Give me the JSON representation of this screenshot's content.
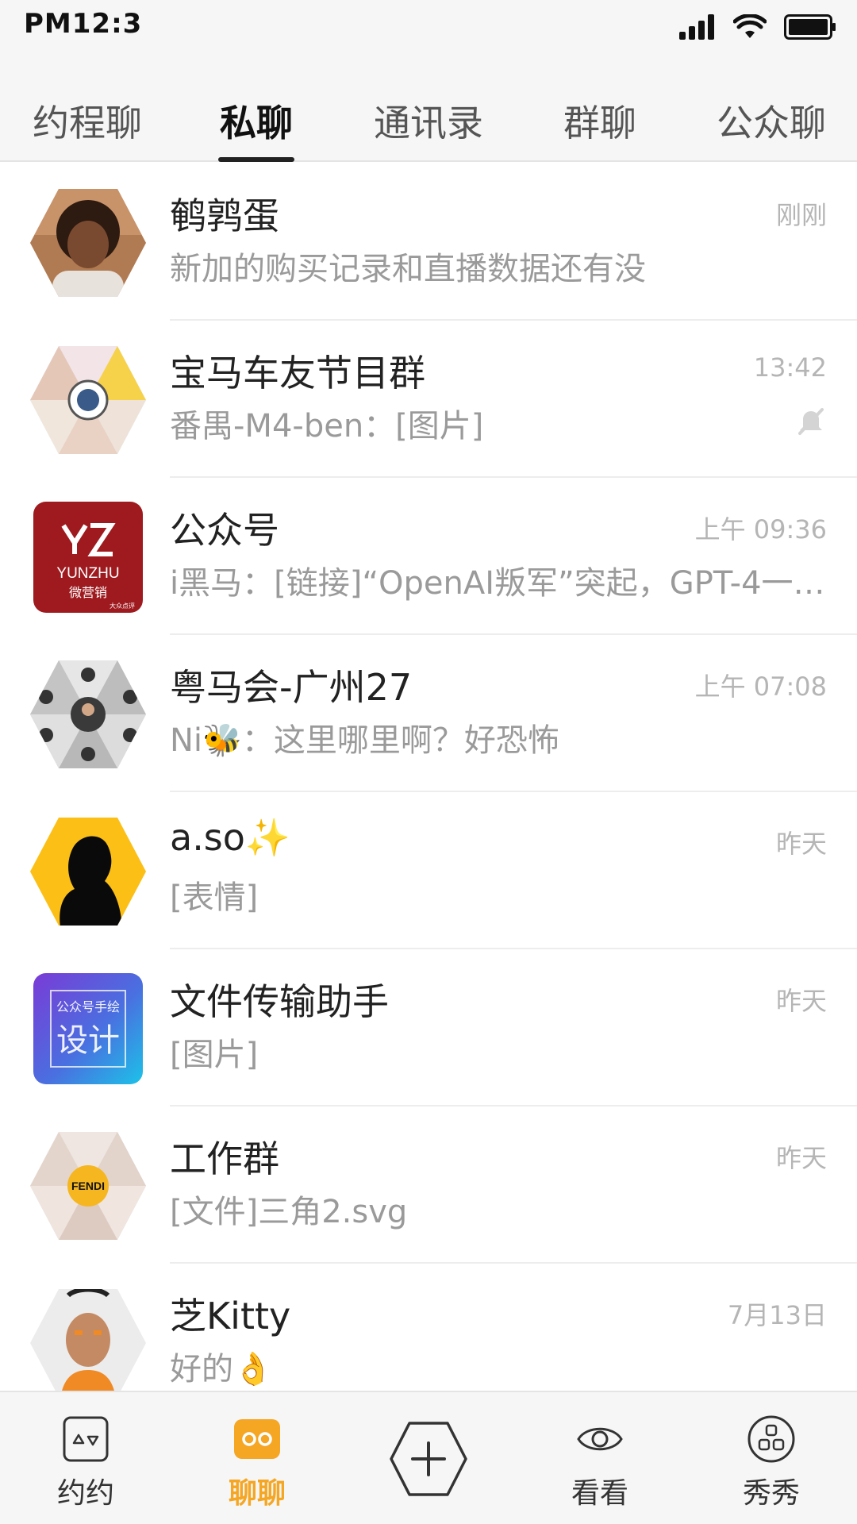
{
  "status_bar": {
    "time": "PM12:3"
  },
  "tabs": [
    {
      "label": "约程聊",
      "active": false
    },
    {
      "label": "私聊",
      "active": true
    },
    {
      "label": "通讯录",
      "active": false
    },
    {
      "label": "群聊",
      "active": false
    },
    {
      "label": "公众聊",
      "active": false
    }
  ],
  "chats": [
    {
      "name": "鹌鹑蛋",
      "time": "刚刚",
      "preview": "新加的购买记录和直播数据还有没",
      "muted": false
    },
    {
      "name": "宝马车友节目群",
      "time": "13:42",
      "preview": "番禺-M4-ben：[图片]",
      "muted": true
    },
    {
      "name": "公众号",
      "time": "上午 09:36",
      "preview": "i黑马：[链接]“OpenAI叛军”突起，GPT-4一夜…",
      "muted": false,
      "avatar_text": [
        "YUNZHU",
        "微营销",
        "大众点评"
      ]
    },
    {
      "name": "粤马会-广州27",
      "time": "上午 07:08",
      "preview": "Ni🐝：这里哪里啊？好恐怖",
      "muted": false
    },
    {
      "name": "a.so✨",
      "time": "昨天",
      "preview": "[表情]",
      "muted": false
    },
    {
      "name": "文件传输助手",
      "time": "昨天",
      "preview": "[图片]",
      "muted": false,
      "avatar_text": [
        "公众号手绘",
        "设计"
      ]
    },
    {
      "name": "工作群",
      "time": "昨天",
      "preview": "[文件]三角2.svg",
      "muted": false,
      "avatar_text": [
        "FENDI"
      ]
    },
    {
      "name": "芝Kitty",
      "time": "7月13日",
      "preview": "好的👌",
      "muted": false
    }
  ],
  "bottom_nav": [
    {
      "label": "约约",
      "icon": "calendar-icon",
      "active": false
    },
    {
      "label": "聊聊",
      "icon": "chat-bubble-icon",
      "active": true
    },
    {
      "label": "",
      "icon": "plus-hexagon-icon",
      "active": false
    },
    {
      "label": "看看",
      "icon": "eye-icon",
      "active": false
    },
    {
      "label": "秀秀",
      "icon": "apps-icon",
      "active": false
    }
  ],
  "colors": {
    "accent": "#f5a623",
    "text_primary": "#222222",
    "text_secondary": "#9a9a9a",
    "time": "#b5b5b5"
  }
}
